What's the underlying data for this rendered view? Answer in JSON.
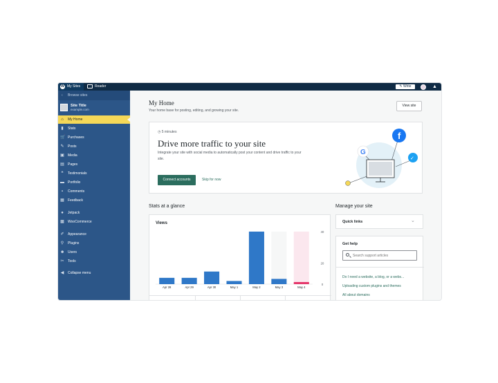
{
  "topbar": {
    "my_sites": "My Sites",
    "reader": "Reader",
    "write": "Write",
    "icons": [
      "wordpress-icon",
      "reader-icon",
      "avatar",
      "bell-icon"
    ]
  },
  "sidebar": {
    "back_label": "Browse sites",
    "site_title": "Site Title",
    "site_url": "example.com",
    "items": [
      {
        "label": "My Home",
        "icon": "home-icon",
        "glyph": "⌂",
        "active": true
      },
      {
        "label": "Stats",
        "icon": "stats-icon",
        "glyph": "▮"
      },
      {
        "label": "Purchases",
        "icon": "cart-icon",
        "glyph": "🛒"
      },
      {
        "label": "Posts",
        "icon": "pin-icon",
        "glyph": "✎"
      },
      {
        "label": "Media",
        "icon": "media-icon",
        "glyph": "▣"
      },
      {
        "label": "Pages",
        "icon": "pages-icon",
        "glyph": "▤"
      },
      {
        "label": "Testimonials",
        "icon": "testimonials-icon",
        "glyph": "❝"
      },
      {
        "label": "Portfolio",
        "icon": "portfolio-icon",
        "glyph": "▬"
      },
      {
        "label": "Comments",
        "icon": "comments-icon",
        "glyph": "▪"
      },
      {
        "label": "Feedback",
        "icon": "feedback-icon",
        "glyph": "▦"
      },
      {
        "label": "Jetpack",
        "icon": "jetpack-icon",
        "glyph": "●"
      },
      {
        "label": "WooCommerce",
        "icon": "woocommerce-icon",
        "glyph": "▩"
      },
      {
        "label": "Appearance",
        "icon": "brush-icon",
        "glyph": "✐"
      },
      {
        "label": "Plugins",
        "icon": "plugins-icon",
        "glyph": "⚲"
      },
      {
        "label": "Users",
        "icon": "users-icon",
        "glyph": "☻"
      },
      {
        "label": "Tools",
        "icon": "tools-icon",
        "glyph": "✂"
      },
      {
        "label": "Collapse menu",
        "icon": "collapse-icon",
        "glyph": "◀"
      }
    ]
  },
  "header": {
    "title": "My Home",
    "subtitle": "Your home base for posting, editing, and growing your site.",
    "view_site": "View site"
  },
  "promo": {
    "time": "5 minutes",
    "title": "Drive more traffic to your site",
    "body": "Integrate your site with social media to automatically post your content and drive traffic to your site.",
    "primary": "Connect accounts",
    "secondary": "Skip for now"
  },
  "stats": {
    "section_title": "Stats at a glance",
    "views_label": "Views"
  },
  "chart_data": {
    "type": "bar",
    "categories": [
      "Apr 28",
      "Apr 29",
      "Apr 30",
      "May 1",
      "May 2",
      "May 3",
      "May 4"
    ],
    "values": [
      6,
      6,
      12,
      3,
      50,
      5,
      2
    ],
    "ylim": [
      0,
      50
    ],
    "yticks": [
      "40",
      "20",
      "0"
    ],
    "highlight_index": 6,
    "highlight_color": "#e5376b",
    "bar_color": "#2f78c8"
  },
  "manage": {
    "section_title": "Manage your site",
    "quick_links": "Quick links",
    "get_help": "Get help",
    "search_placeholder": "Search support articles",
    "links": [
      "Do I need a website, a blog, or a webs...",
      "Uploading custom plugins and themes",
      "All about domains"
    ]
  },
  "colors": {
    "sidebar": "#2c5688",
    "topbar": "#102b45",
    "active": "#f5d858",
    "accent_green": "#2b6d5e"
  }
}
